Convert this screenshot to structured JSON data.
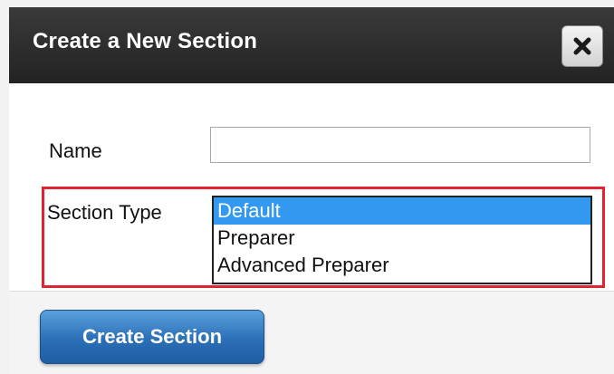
{
  "dialog": {
    "title": "Create a New Section",
    "close_icon": "close-x-icon"
  },
  "form": {
    "name_label": "Name",
    "name_value": "",
    "name_placeholder": "",
    "section_type_label": "Section Type",
    "section_type_options": [
      {
        "label": "Default",
        "selected": true
      },
      {
        "label": "Preparer",
        "selected": false
      },
      {
        "label": "Advanced Preparer",
        "selected": false
      }
    ],
    "highlight_color": "#e32232"
  },
  "footer": {
    "create_button_label": "Create Section"
  },
  "colors": {
    "titlebar": "#2d2d2d",
    "selection": "#3399f0",
    "primary_button": "#2b6fb7"
  }
}
